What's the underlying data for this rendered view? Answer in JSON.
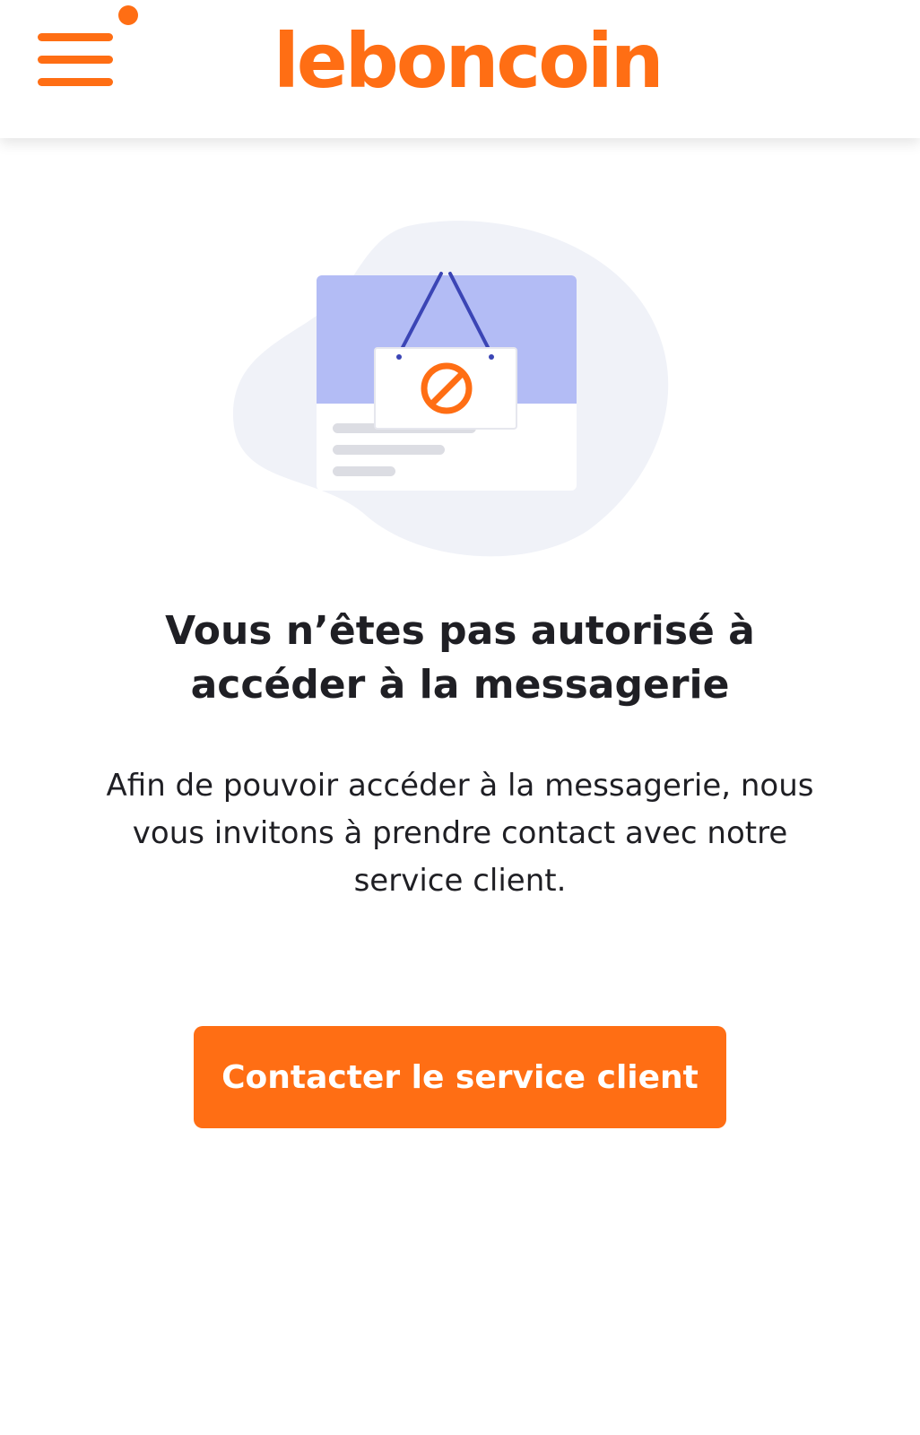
{
  "header": {
    "logo_text": "leboncoin",
    "menu_icon": "hamburger-menu-icon",
    "notification_dot": true
  },
  "illustration": {
    "icon": "blocked-sign-icon"
  },
  "main": {
    "title": "Vous n’êtes pas autorisé à accéder à la messagerie",
    "description": "Afin de pouvoir accéder à la messagerie, nous vous invitons à prendre contact avec notre service client.",
    "button_label": "Contacter le service client"
  },
  "colors": {
    "brand": "#ff6e14",
    "text": "#1f1f24",
    "illustration_blue": "#b3bcf5",
    "illustration_string": "#3b45b5",
    "blob": "#f0f2f8"
  }
}
